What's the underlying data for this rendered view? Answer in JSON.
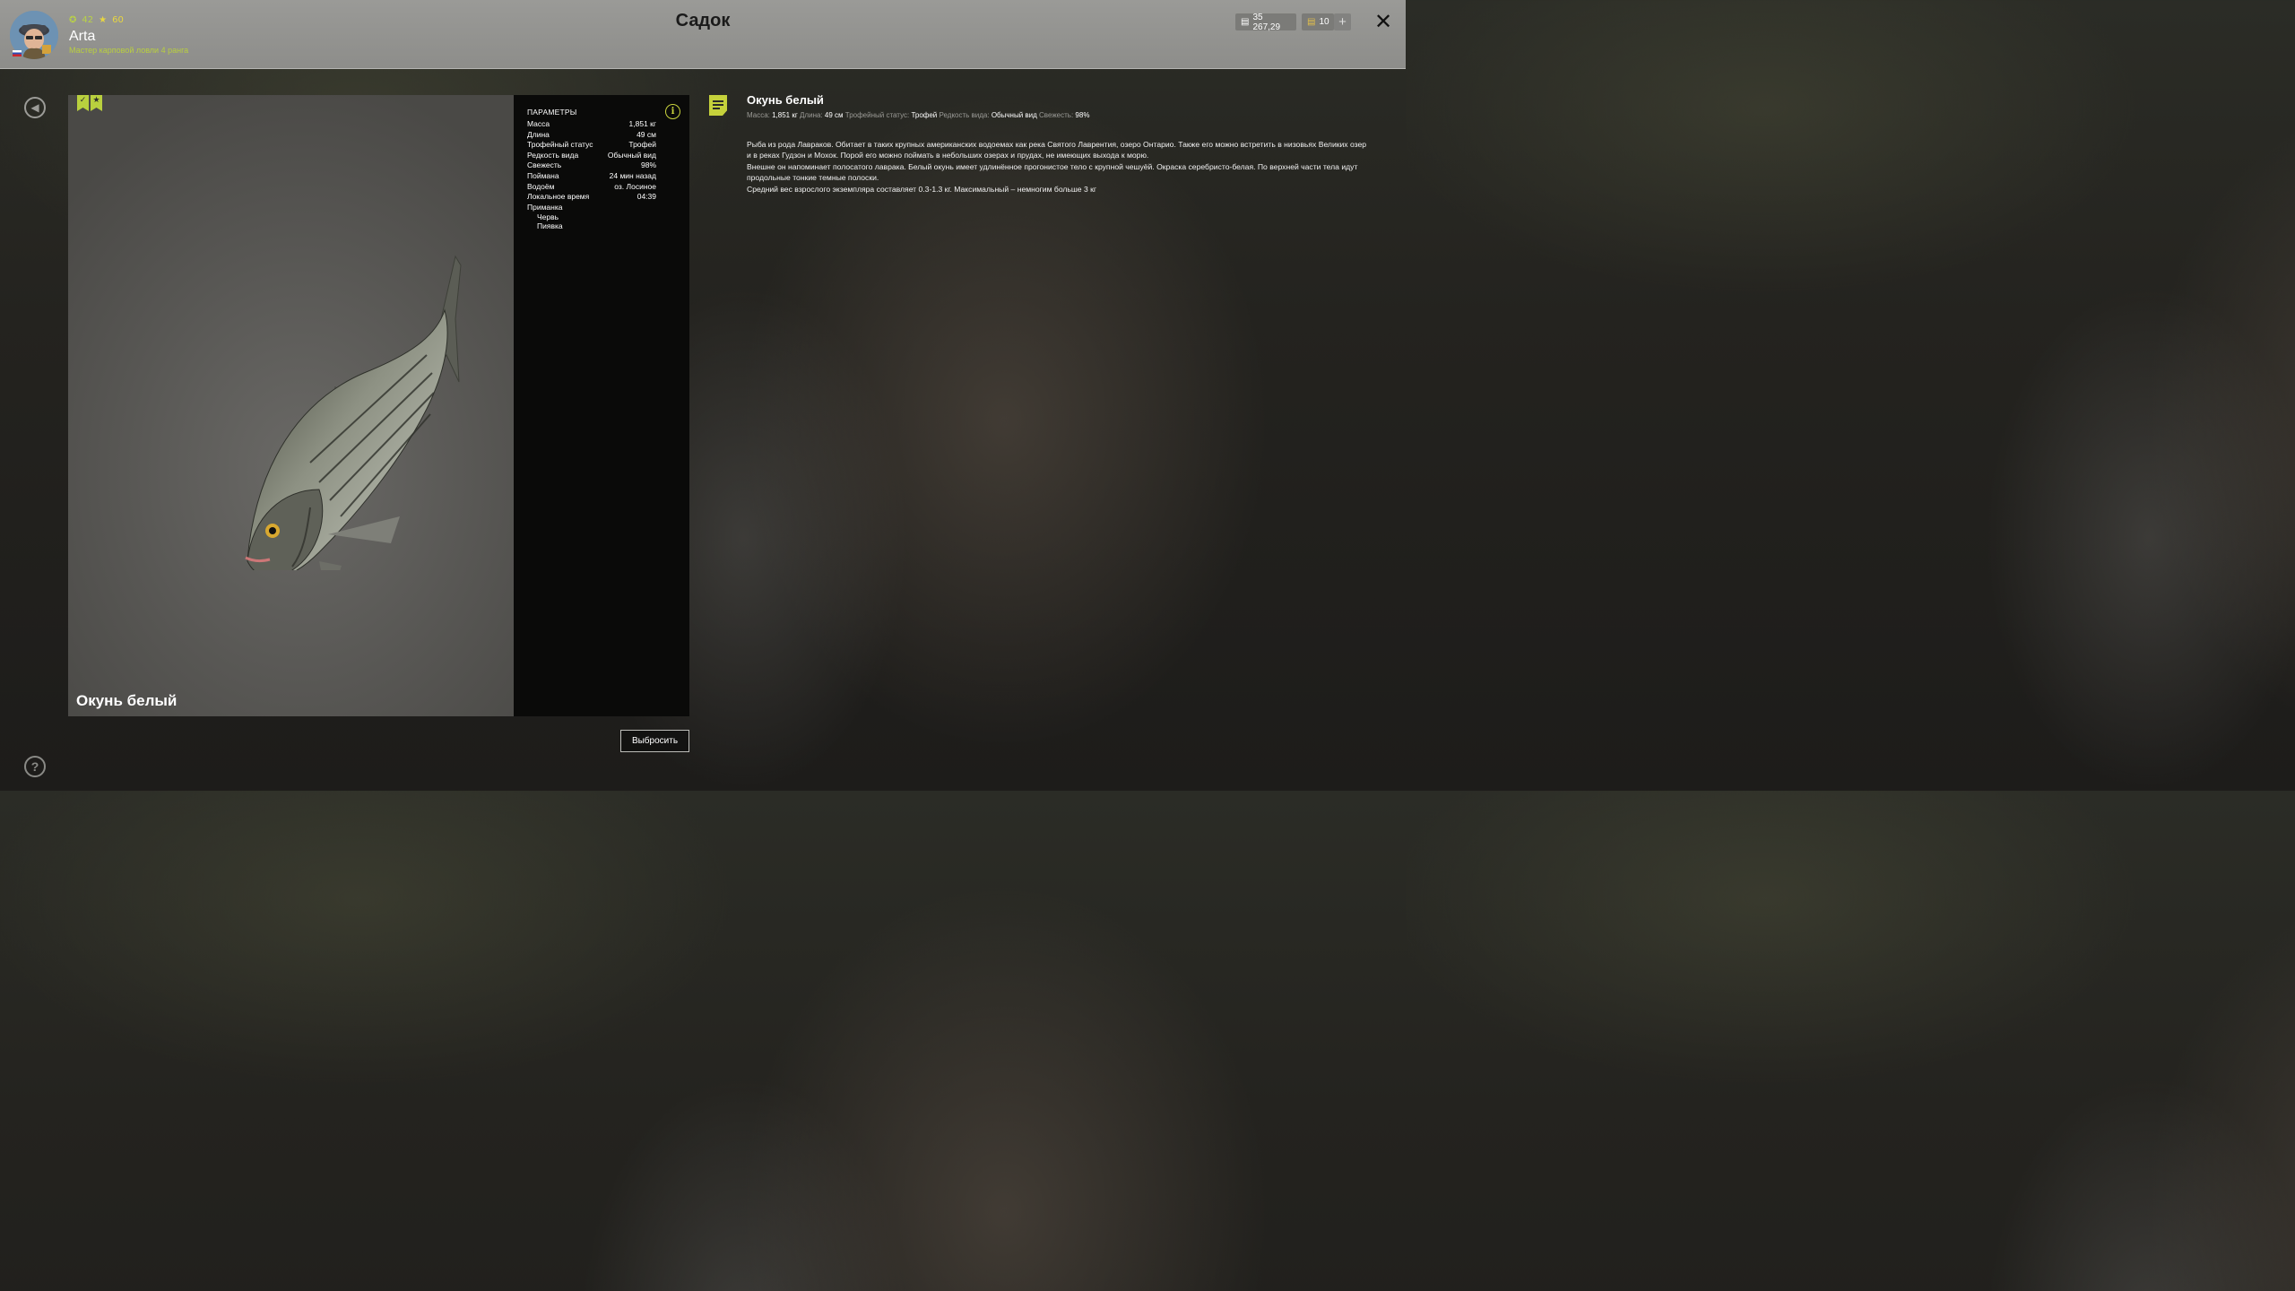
{
  "header": {
    "title": "Садок",
    "player": {
      "name": "Arta",
      "level": "42",
      "stars": "60",
      "rank": "Мастер карповой ловли 4 ранга"
    },
    "currency": {
      "silver": "35 267,29",
      "gold": "10",
      "add_label": "+"
    },
    "close_label": "✕"
  },
  "fish": {
    "name": "Окунь белый",
    "params_title": "ПАРАМЕТРЫ",
    "params": [
      {
        "label": "Масса",
        "value": "1,851 кг"
      },
      {
        "label": "Длина",
        "value": "49 см"
      },
      {
        "label": "Трофейный статус",
        "value": "Трофей"
      },
      {
        "label": "Редкость вида",
        "value": "Обычный вид"
      },
      {
        "label": "Свежесть",
        "value": "98%"
      },
      {
        "label": "Поймана",
        "value": "24 мин назад"
      },
      {
        "label": "Водоём",
        "value": "оз. Лосиное"
      },
      {
        "label": "Локальное время",
        "value": "04:39"
      }
    ],
    "bait_label": "Приманка",
    "baits": [
      "Червь",
      "Пиявка"
    ]
  },
  "description": {
    "title": "Окунь белый",
    "meta": {
      "mass_label": "Масса:",
      "mass": "1,851 кг",
      "length_label": "Длина:",
      "length": "49 см",
      "trophy_label": "Трофейный статус:",
      "trophy": "Трофей",
      "rarity_label": "Редкость вида:",
      "rarity": "Обычный вид",
      "fresh_label": "Свежесть:",
      "fresh": "98%"
    },
    "paragraphs": [
      "Рыба из рода Лавраков. Обитает в таких крупных американских водоемах как река Святого Лаврентия, озеро Онтарио. Также его можно встретить в низовьях Великих озер и в реках Гудзон и Мохок. Порой его можно поймать в небольших озерах и прудах, не имеющих выхода к морю.",
      "Внешне он напоминает полосатого лаврака. Белый окунь имеет удлинённое прогонистое тело с крупной чешуёй. Окраска серебристо-белая. По верхней части тела идут продольные тонкие темные полоски.",
      "Средний вес взрослого экземпляра составляет 0.3-1.3 кг. Максимальный – немногим больше 3 кг"
    ]
  },
  "actions": {
    "release_label": "Выбросить",
    "help_label": "?"
  },
  "colors": {
    "accent": "#c5d13b",
    "topbar": "#929290",
    "panel": "#0a0a09"
  }
}
